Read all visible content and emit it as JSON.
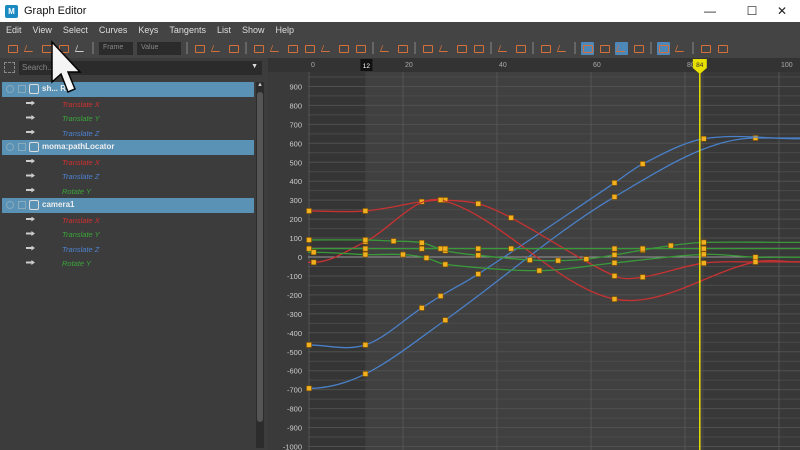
{
  "window": {
    "title": "Graph Editor",
    "minimize": "—",
    "maximize": "☐",
    "close": "✕"
  },
  "menu": [
    "Edit",
    "View",
    "Select",
    "Curves",
    "Keys",
    "Tangents",
    "List",
    "Show",
    "Help"
  ],
  "toolbar": {
    "frame_placeholder": "Frame",
    "value_placeholder": "Value",
    "icons_left": [
      "move-key-icon",
      "insert-key-icon",
      "lattice-deform-icon",
      "region-select-icon",
      "timeline-snap-icon"
    ],
    "icons_right": [
      "frame-all-icon",
      "frame-playback-icon",
      "center-current-icon",
      "auto-tangent-icon",
      "spline-tangent-icon",
      "clamped-tangent-icon",
      "linear-tangent-icon",
      "flat-tangent-icon",
      "step-tangent-icon",
      "plateau-tangent-icon",
      "buffer-curve-snapshot-icon",
      "swap-buffer-icon",
      "break-tangent-icon",
      "unify-tangent-icon",
      "free-tangent-weight-icon",
      "lock-tangent-weight-icon",
      "pre-infinity-icon",
      "post-infinity-icon",
      "normalize-icon",
      "denormalize-icon",
      "auto-load-icon",
      "load-selected-icon",
      "time-snap-icon",
      "value-snap-icon",
      "stacked-curves-icon",
      "isolate-curve-icon",
      "open-dope-sheet-icon",
      "open-trax-icon"
    ],
    "active_icons": [
      "auto-load-icon",
      "time-snap-icon",
      "stacked-curves-icon"
    ]
  },
  "outliner": {
    "search_placeholder": "Search...",
    "groups": [
      {
        "name": "sh... RP",
        "attrs": [
          {
            "label": "Translate X",
            "color": "#d03030"
          },
          {
            "label": "Translate Y",
            "color": "#3aa53a"
          },
          {
            "label": "Translate Z",
            "color": "#4d82d0"
          }
        ]
      },
      {
        "name": "moma:pathLocator",
        "attrs": [
          {
            "label": "Translate X",
            "color": "#d03030"
          },
          {
            "label": "Translate Z",
            "color": "#4d82d0"
          },
          {
            "label": "Rotate Y",
            "color": "#3aa53a"
          }
        ]
      },
      {
        "name": "camera1",
        "attrs": [
          {
            "label": "Translate X",
            "color": "#d03030"
          },
          {
            "label": "Translate Y",
            "color": "#3aa53a"
          },
          {
            "label": "Translate Z",
            "color": "#4d82d0"
          },
          {
            "label": "Rotate Y",
            "color": "#3aa53a"
          }
        ]
      }
    ]
  },
  "chart_data": {
    "type": "line",
    "x_ticks": [
      0,
      20,
      40,
      60,
      80,
      100
    ],
    "y_ticks": [
      900,
      800,
      700,
      600,
      500,
      400,
      300,
      200,
      100,
      0,
      -100,
      -200,
      -300,
      -400,
      -500,
      -600,
      -700,
      -800,
      -900,
      -1000
    ],
    "xlim": [
      0,
      104
    ],
    "ylim": [
      -1000,
      950
    ],
    "playback_range": [
      12,
      84
    ],
    "range_start_label": "12",
    "current_frame": 84,
    "current_frame_label": "84",
    "grid": true,
    "colors": {
      "red": "#c83232",
      "green": "#3a9a3a",
      "blue": "#4a80c8",
      "key": "#f0b020",
      "current_time": "#e8e000"
    },
    "series": [
      {
        "color": "blue",
        "keys": [
          [
            0,
            -693
          ],
          [
            12,
            -617
          ],
          [
            29,
            -333
          ],
          [
            65,
            317
          ],
          [
            95,
            628
          ]
        ]
      },
      {
        "color": "blue",
        "keys": [
          [
            0,
            -464
          ],
          [
            12,
            -464
          ],
          [
            24,
            -269
          ],
          [
            28,
            -206
          ],
          [
            36,
            -90
          ],
          [
            65,
            391
          ],
          [
            71,
            491
          ],
          [
            84,
            624
          ],
          [
            104,
            624
          ]
        ]
      },
      {
        "color": "red",
        "keys": [
          [
            0,
            243
          ],
          [
            12,
            243
          ],
          [
            24,
            292
          ],
          [
            28,
            301
          ],
          [
            29,
            301
          ],
          [
            36,
            281
          ],
          [
            43,
            207
          ],
          [
            65,
            -100
          ],
          [
            71,
            -106
          ],
          [
            84,
            -32
          ],
          [
            95,
            -26
          ],
          [
            104,
            -26
          ]
        ]
      },
      {
        "color": "red",
        "keys": [
          [
            1,
            -28
          ],
          [
            12,
            81
          ],
          [
            28,
            301
          ],
          [
            65,
            -222
          ],
          [
            95,
            -26
          ],
          [
            104,
            -26
          ]
        ]
      },
      {
        "color": "green",
        "keys": [
          [
            0,
            90
          ],
          [
            12,
            90
          ],
          [
            18,
            84
          ],
          [
            24,
            75
          ],
          [
            29,
            33
          ],
          [
            36,
            9
          ],
          [
            47,
            -16
          ],
          [
            53,
            -19
          ],
          [
            59,
            -11
          ],
          [
            65,
            11
          ],
          [
            71,
            37
          ],
          [
            77,
            60
          ],
          [
            84,
            77
          ],
          [
            104,
            77
          ]
        ]
      },
      {
        "color": "green",
        "keys": [
          [
            0,
            44
          ],
          [
            12,
            44
          ],
          [
            24,
            44
          ],
          [
            28,
            44
          ],
          [
            29,
            44
          ],
          [
            36,
            44
          ],
          [
            43,
            44
          ],
          [
            65,
            44
          ],
          [
            71,
            44
          ],
          [
            84,
            44
          ],
          [
            104,
            44
          ]
        ]
      },
      {
        "color": "green",
        "keys": [
          [
            1,
            25
          ],
          [
            12,
            13
          ],
          [
            20,
            13
          ],
          [
            25,
            -5
          ],
          [
            29,
            -39
          ],
          [
            49,
            -72
          ],
          [
            65,
            -31
          ],
          [
            84,
            14
          ],
          [
            95,
            -1
          ],
          [
            104,
            -1
          ]
        ]
      }
    ]
  }
}
